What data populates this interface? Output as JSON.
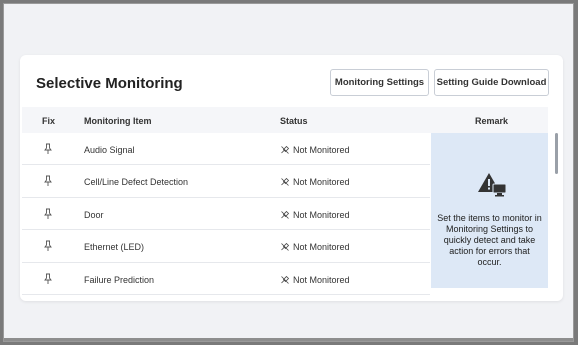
{
  "card": {
    "title": "Selective Monitoring",
    "buttons": {
      "monitoring_settings": "Monitoring Settings",
      "setting_guide_download": "Setting Guide Download"
    }
  },
  "table": {
    "headers": {
      "fix": "Fix",
      "item": "Monitoring Item",
      "status": "Status",
      "remark": "Remark"
    },
    "rows": [
      {
        "item": "Audio Signal",
        "status": "Not Monitored"
      },
      {
        "item": "Cell/Line Defect Detection",
        "status": "Not Monitored"
      },
      {
        "item": "Door",
        "status": "Not Monitored"
      },
      {
        "item": "Ethernet (LED)",
        "status": "Not Monitored"
      },
      {
        "item": "Failure Prediction",
        "status": "Not Monitored"
      }
    ],
    "remark_text": "Set the items to monitor in Monitoring Settings to quickly detect and take action for errors that occur."
  },
  "icons": {
    "fix": "pin-icon",
    "status": "not-monitored-icon",
    "remark": "warning-monitor-icon"
  },
  "colors": {
    "remark_panel": "#dde8f6",
    "header_bg": "#f5f6f9",
    "icon_dark": "#333333"
  }
}
